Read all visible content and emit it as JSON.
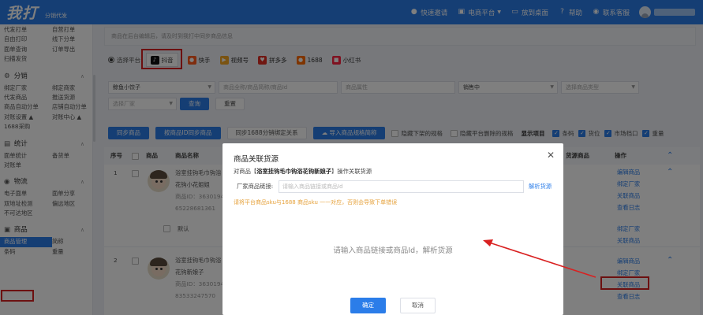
{
  "app": {
    "logo": "我打",
    "subtitle": "分销代发"
  },
  "topnav": [
    {
      "icon": "users-icon",
      "label": "快速邀请"
    },
    {
      "icon": "cart-icon",
      "label": "电商平台",
      "dropdown": true
    },
    {
      "icon": "desktop-icon",
      "label": "放到桌面"
    },
    {
      "icon": "help-icon",
      "label": "帮助"
    },
    {
      "icon": "headset-icon",
      "label": "联系客服"
    }
  ],
  "sidebar": {
    "top_items": [
      "代发打单",
      "自营打单",
      "自由打印",
      "线下分单",
      "面单查询",
      "订单导出",
      "扫描发货"
    ],
    "sections": [
      {
        "title": "分销",
        "icon": "gear-icon",
        "items": [
          "绑定厂家",
          "绑定商家",
          "代发商品",
          "推送货源",
          "商品自动分单",
          "店铺自动分单",
          "对账设置",
          "对账中心",
          "1688采购"
        ]
      },
      {
        "title": "统计",
        "icon": "stats-icon",
        "items": [
          "面单统计",
          "备货单",
          "对账单"
        ]
      },
      {
        "title": "物流",
        "icon": "logistics-icon",
        "items": [
          "电子面单",
          "面单分享",
          "双地址检测",
          "偏远地区",
          "不可达地区"
        ]
      },
      {
        "title": "商品",
        "icon": "goods-icon",
        "items": [
          "商品管理",
          "简称",
          "条码",
          "重量"
        ]
      }
    ]
  },
  "main": {
    "notice": "商品在后台编辑后，请及时到我打中同步商品信息",
    "platform_label": "选择平台:",
    "platforms": [
      {
        "name": "抖音",
        "color": "#111111",
        "selected": true
      },
      {
        "name": "快手",
        "color": "#ff5a1f"
      },
      {
        "name": "视频号",
        "color": "#f5a623"
      },
      {
        "name": "拼多多",
        "color": "#e02e24"
      },
      {
        "name": "1688",
        "color": "#ff6a00"
      },
      {
        "name": "小红书",
        "color": "#ff2442"
      }
    ],
    "filters": {
      "shop": "鲸鱼小饺子",
      "product_placeholder": "商品全称/商品简称/商品Id",
      "attr_placeholder": "商品属性",
      "status": "销售中",
      "type_placeholder": "选择商品类型",
      "vendor_placeholder": "选择厂家",
      "search": "查询",
      "reset": "重置"
    },
    "actions": {
      "sync": "同步商品",
      "sync_by_id": "按商品ID同步商品",
      "sync_1688": "同步1688分销绑定关系",
      "import": "导入商品规格简称",
      "hide_off": "隐藏下架的规格",
      "hide_deleted": "隐藏平台删除的规格",
      "show_label": "显示项目",
      "show_items": [
        "条码",
        "货位",
        "市场档口",
        "重量"
      ]
    },
    "table": {
      "headers": [
        "序号",
        "商品",
        "商品名称",
        "货源商品",
        "操作"
      ],
      "rows": [
        {
          "index": "1",
          "name1": "浴室挂钩毛巾钩浴",
          "name2": "花钩小花姐姐",
          "id_label": "商品ID：",
          "id_val": "36301948",
          "id2": "65228681361",
          "spec": "默认",
          "ops": [
            "编辑商品",
            "绑定厂家",
            "关联商品",
            "查看日志"
          ],
          "ops2": [
            "绑定厂家",
            "关联商品"
          ]
        },
        {
          "index": "2",
          "name1": "浴室挂钩毛巾钩浴",
          "name2": "花钩新娘子",
          "id_label": "商品ID：",
          "id_val": "36301948",
          "id2": "83533247570",
          "spec": "默认",
          "ops": [
            "编辑商品",
            "绑定厂家",
            "关联商品",
            "查看日志"
          ]
        }
      ]
    }
  },
  "dialog": {
    "title": "商品关联货源",
    "line_prefix": "对商品【",
    "product": "浴室挂钩毛巾钩浴花钩新娘子",
    "line_suffix": "】操作关联货源",
    "field_label": "厂家商品链接:",
    "field_placeholder": "请输入商品链接或商品Id",
    "parse": "解析货源",
    "warning": "请将平台商品sku与1688 商品sku 一一对应，否则会导致下单错误",
    "empty": "请输入商品链接或商品Id，解析货源",
    "ok": "确定",
    "cancel": "取消"
  }
}
